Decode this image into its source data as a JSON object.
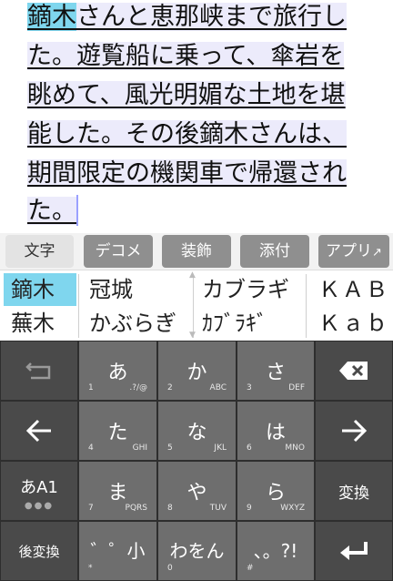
{
  "editor": {
    "lines": [
      {
        "hl": "鏑木",
        "rest": "さんと恵那峡まで旅行し"
      },
      {
        "hl": "",
        "rest": "た。遊覧船に乗って、傘岩を"
      },
      {
        "hl": "",
        "rest": "眺めて、風光明媚な土地を堪"
      },
      {
        "hl": "",
        "rest": "能した。その後鏑木さんは、"
      },
      {
        "hl": "",
        "rest": "期間限定の機関車で帰還され"
      },
      {
        "hl": "",
        "rest": "た。"
      }
    ]
  },
  "tabs": [
    "文字",
    "デコメ",
    "装飾",
    "添付",
    "アプリ"
  ],
  "candidates": {
    "col1": [
      "鏑木",
      "蕪木"
    ],
    "col2": [
      "冠城",
      "かぶらぎ"
    ],
    "col3": [
      "カブラギ",
      "ｶﾌﾞﾗｷﾞ"
    ],
    "col4": [
      "ＫＡＢＵ",
      "Ｋａｂ"
    ]
  },
  "keyboard": {
    "row1": [
      {
        "main": "あ",
        "num": "1",
        "hint": ".?/@"
      },
      {
        "main": "か",
        "num": "2",
        "hint": "ABC"
      },
      {
        "main": "さ",
        "num": "3",
        "hint": "DEF"
      }
    ],
    "row2": [
      {
        "main": "た",
        "num": "4",
        "hint": "GHI"
      },
      {
        "main": "な",
        "num": "5",
        "hint": "JKL"
      },
      {
        "main": "は",
        "num": "6",
        "hint": "MNO"
      }
    ],
    "row3": [
      {
        "main": "ま",
        "num": "7",
        "hint": "PQRS"
      },
      {
        "main": "や",
        "num": "8",
        "hint": "TUV"
      },
      {
        "main": "ら",
        "num": "9",
        "hint": "WXYZ"
      }
    ],
    "row4": [
      {
        "main": "゛゜小",
        "num": "*",
        "hint": ""
      },
      {
        "main": "わをん",
        "num": "0",
        "hint": ""
      },
      {
        "main": "、。?!",
        "num": "#",
        "hint": ""
      }
    ],
    "mode_label": "あA1",
    "convert_label": "変換",
    "reconvert_label": "後変換"
  }
}
